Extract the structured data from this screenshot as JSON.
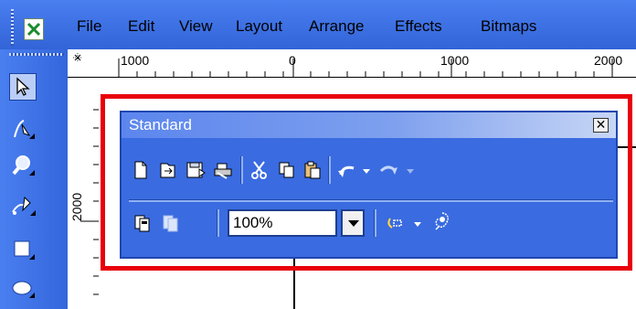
{
  "menubar": {
    "items": [
      {
        "label": "File"
      },
      {
        "label": "Edit"
      },
      {
        "label": "View"
      },
      {
        "label": "Layout"
      },
      {
        "label": "Arrange"
      },
      {
        "label": "Effects"
      },
      {
        "label": "Bitmaps"
      }
    ]
  },
  "ruler": {
    "h_ticks": [
      "1000",
      "0",
      "1000",
      "2000"
    ],
    "v_label": "2000"
  },
  "standard_toolbar": {
    "title": "Standard",
    "close_glyph": "✕",
    "zoom_value": "100%"
  },
  "colors": {
    "accent": "#3a6be0",
    "highlight": "#e8000b"
  }
}
